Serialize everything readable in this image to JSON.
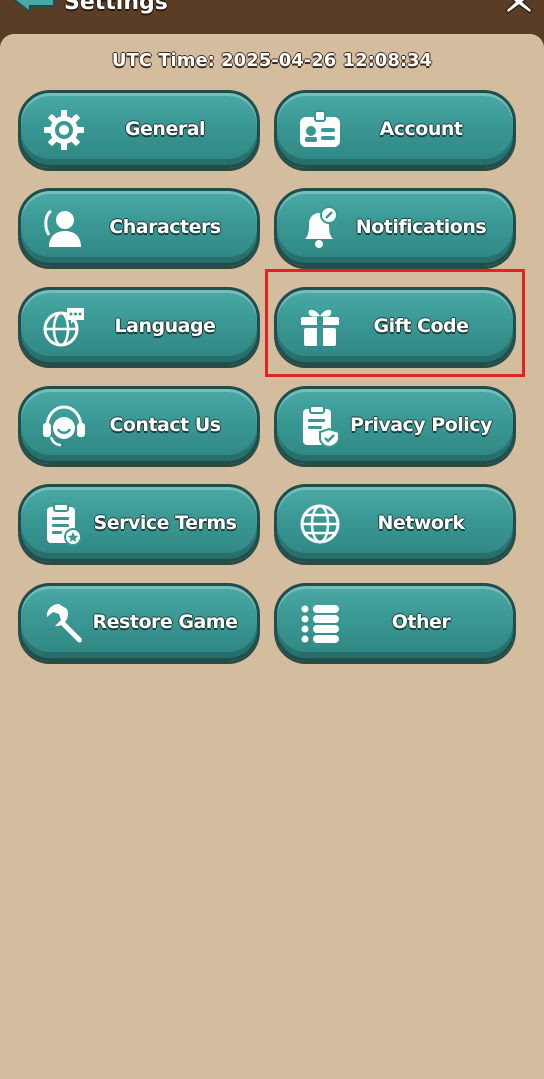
{
  "header": {
    "title": "Settings"
  },
  "utc_time": "UTC Time: 2025-04-26 12:08:34",
  "menu": {
    "general": "General",
    "account": "Account",
    "characters": "Characters",
    "notifications": "Notifications",
    "language": "Language",
    "gift_code": "Gift Code",
    "contact_us": "Contact Us",
    "privacy_policy": "Privacy Policy",
    "service_terms": "Service Terms",
    "network": "Network",
    "restore_game": "Restore Game",
    "other": "Other"
  },
  "icons": {
    "general": "gear-icon",
    "account": "id-card-icon",
    "characters": "user-icon",
    "notifications": "bell-icon",
    "language": "globe-chat-icon",
    "gift_code": "gift-icon",
    "contact_us": "headset-icon",
    "privacy_policy": "clipboard-shield-icon",
    "service_terms": "document-badge-icon",
    "network": "globe-icon",
    "restore_game": "wrench-icon",
    "other": "list-icon"
  },
  "colors": {
    "panel": "#d4bc9f",
    "button": "#3a9894",
    "highlight": "#e02424"
  }
}
